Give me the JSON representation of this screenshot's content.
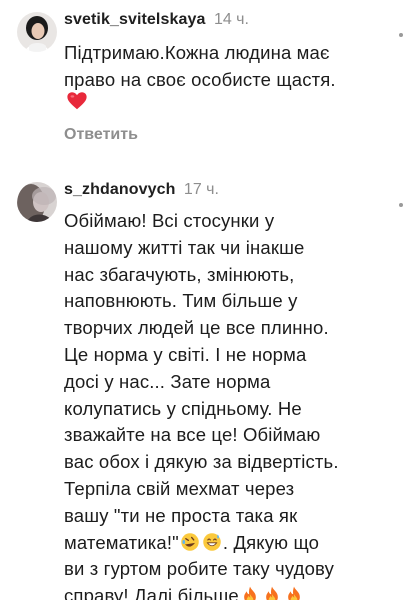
{
  "comments": [
    {
      "username": "svetik_svitelskaya",
      "time": "14 ч.",
      "lines": [
        "Підтримаю.Кожна людина має",
        "право на своє особисте щастя."
      ],
      "emoji": "red-heart",
      "reply_label": "Ответить"
    },
    {
      "username": "s_zhdanovych",
      "time": "17 ч.",
      "lines": [
        "Обіймаю! Всі стосунки у",
        "нашому житті так чи інакше",
        "нас збагачують, змінюють,",
        "наповнюють. Тим більше у",
        "творчих людей це все плинно.",
        "Це норма у світі. І не норма",
        "досі у нас... Зате норма",
        "колупатись у спідньому. Не",
        "зважайте на все це! Обіймаю",
        "вас обох і дякую за відвертість.",
        "Терпіла свій мехмат через",
        "вашу \"ти не проста така як"
      ],
      "line_13_text": "математика!\"",
      "line_13_suffix": ". Дякую що",
      "line_14": "ви з гуртом робите таку чудову",
      "line_15": "справу! Далі більше",
      "emojis": [
        "rofl-emoji",
        "grinning-sweat-emoji",
        "fire-emoji",
        "fire-emoji",
        "fire-emoji"
      ]
    }
  ]
}
